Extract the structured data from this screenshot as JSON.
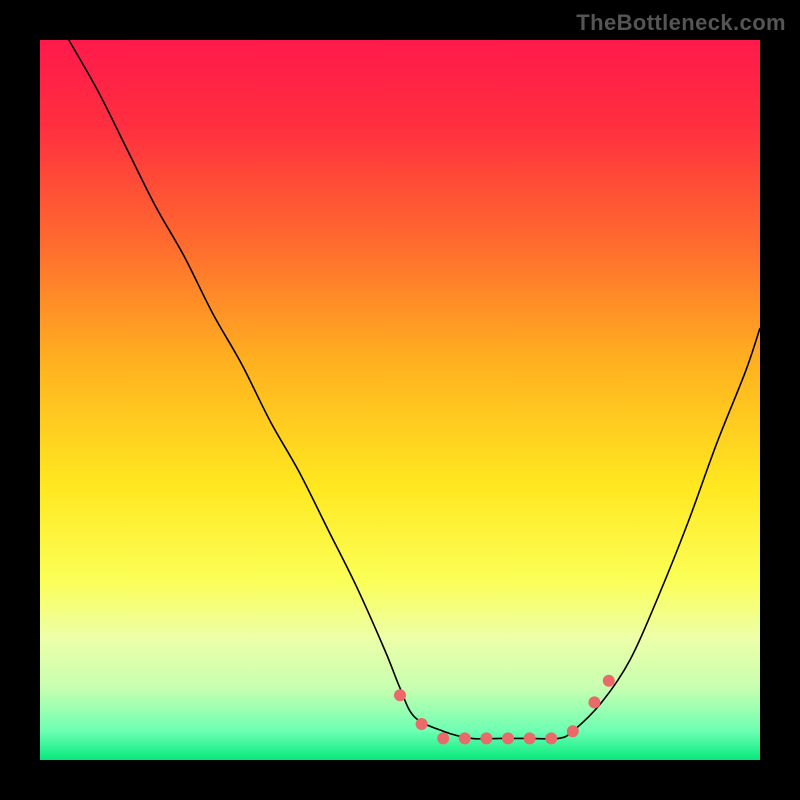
{
  "watermark": "TheBottleneck.com",
  "chart_data": {
    "type": "line",
    "title": "",
    "xlabel": "",
    "ylabel": "",
    "xlim": [
      0,
      100
    ],
    "ylim": [
      0,
      100
    ],
    "grid": false,
    "legend": false,
    "background_gradient": {
      "stops": [
        {
          "offset": 0.0,
          "color": "#ff1a4b"
        },
        {
          "offset": 0.12,
          "color": "#ff2f3f"
        },
        {
          "offset": 0.28,
          "color": "#ff6a2f"
        },
        {
          "offset": 0.45,
          "color": "#ffb21f"
        },
        {
          "offset": 0.62,
          "color": "#ffe820"
        },
        {
          "offset": 0.75,
          "color": "#fbff57"
        },
        {
          "offset": 0.83,
          "color": "#edffa8"
        },
        {
          "offset": 0.9,
          "color": "#c7ffb0"
        },
        {
          "offset": 0.96,
          "color": "#6cffb3"
        },
        {
          "offset": 1.0,
          "color": "#06e97c"
        }
      ]
    },
    "series": [
      {
        "name": "curve",
        "stroke": "#000000",
        "stroke_width": 1.6,
        "x": [
          4,
          8,
          12,
          16,
          20,
          24,
          28,
          32,
          36,
          40,
          44,
          48,
          50,
          52,
          56,
          60,
          64,
          68,
          72,
          74,
          78,
          82,
          86,
          90,
          94,
          98,
          100
        ],
        "y": [
          100,
          93,
          85,
          77,
          70,
          62,
          55,
          47,
          40,
          32,
          24,
          15,
          10,
          6,
          4,
          3,
          3,
          3,
          3,
          4,
          8,
          14,
          23,
          33,
          44,
          54,
          60
        ]
      }
    ],
    "markers": {
      "color": "#ea6a6a",
      "radius": 6,
      "points": [
        {
          "x": 50,
          "y": 9
        },
        {
          "x": 53,
          "y": 5
        },
        {
          "x": 56,
          "y": 3
        },
        {
          "x": 59,
          "y": 3
        },
        {
          "x": 62,
          "y": 3
        },
        {
          "x": 65,
          "y": 3
        },
        {
          "x": 68,
          "y": 3
        },
        {
          "x": 71,
          "y": 3
        },
        {
          "x": 74,
          "y": 4
        },
        {
          "x": 77,
          "y": 8
        },
        {
          "x": 79,
          "y": 11
        }
      ]
    }
  }
}
